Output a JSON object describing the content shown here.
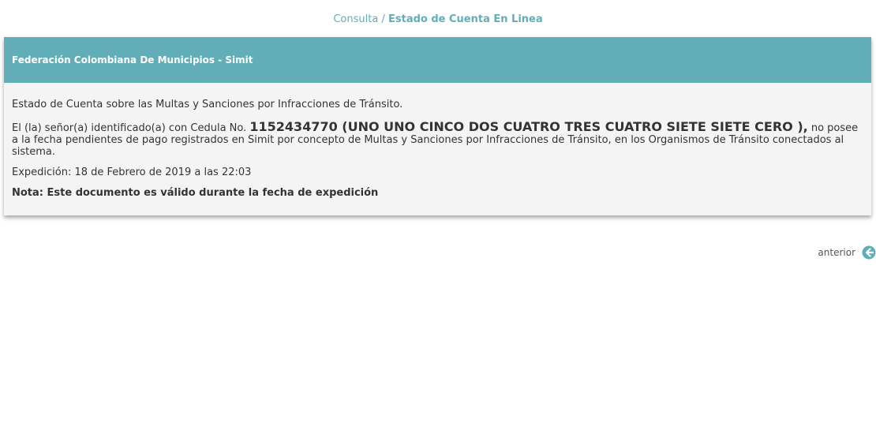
{
  "breadcrumb": {
    "parent": "Consulta",
    "separator": "/",
    "current": "Estado de Cuenta En Linea"
  },
  "panel": {
    "header": "Federación Colombiana De Municipios - Simit",
    "intro": "Estado de Cuenta sobre las Multas y Sanciones por Infracciones de Tránsito.",
    "statement_prefix": "El (la) señor(a) identificado(a) con Cedula No. ",
    "id_text": "1152434770 (UNO UNO CINCO DOS CUATRO TRES CUATRO SIETE SIETE CERO ),",
    "statement_suffix": " no posee a la fecha pendientes de pago registrados en Simit por concepto de Multas y Sanciones por Infracciones de Tránsito, en los Organismos de Tránsito conectados al sistema.",
    "expedition": "Expedición: 18 de Febrero de 2019 a las 22:03",
    "note": "Nota: Este documento es válido durante la fecha de expedición"
  },
  "nav": {
    "back_label": "anterior",
    "back_icon": "arrow-left-circle-icon"
  },
  "colors": {
    "accent": "#62aeb8",
    "panel_bg": "#f4f4f4"
  }
}
